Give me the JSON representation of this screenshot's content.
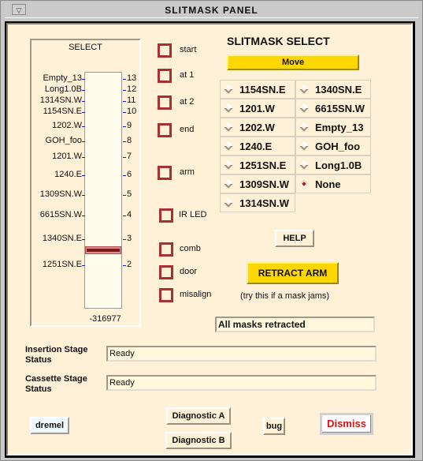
{
  "window": {
    "title": "SLITMASK PANEL",
    "menu_icon": "triangle-down-icon"
  },
  "gauge": {
    "title": "SELECT",
    "positions": [
      {
        "name": "Empty_13",
        "index": "13"
      },
      {
        "name": "Long1.0B",
        "index": "12"
      },
      {
        "name": "1314SN.W",
        "index": "11"
      },
      {
        "name": "1154SN.E",
        "index": "10"
      },
      {
        "name": "1202.W",
        "index": "9"
      },
      {
        "name": "GOH_foo",
        "index": "8"
      },
      {
        "name": "1201.W",
        "index": "7"
      },
      {
        "name": "1240.E",
        "index": "6"
      },
      {
        "name": "1309SN.W",
        "index": "5"
      },
      {
        "name": "6615SN.W",
        "index": "4"
      },
      {
        "name": "1340SN.E",
        "index": "3"
      },
      {
        "name": "1251SN.E",
        "index": "2"
      }
    ],
    "current_position": "3",
    "readout": "-316977"
  },
  "indicators": [
    {
      "label": "start"
    },
    {
      "label": "at 1"
    },
    {
      "label": "at 2"
    },
    {
      "label": "end"
    },
    {
      "label": "arm"
    },
    {
      "label": "IR LED"
    },
    {
      "label": "comb"
    },
    {
      "label": "door"
    },
    {
      "label": "misalign"
    }
  ],
  "slitmask_select": {
    "title": "SLITMASK SELECT",
    "move_label": "Move",
    "options_col1": [
      "1154SN.E",
      "1201.W",
      "1202.W",
      "1240.E",
      "1251SN.E",
      "1309SN.W",
      "1314SN.W"
    ],
    "options_col2": [
      "1340SN.E",
      "6615SN.W",
      "Empty_13",
      "GOH_foo",
      "Long1.0B",
      "None"
    ],
    "selected": "None"
  },
  "help_label": "HELP",
  "retract_label": "RETRACT ARM",
  "retract_hint": "(try this if a mask jams)",
  "mask_status": "All masks retracted",
  "insertion_stage": {
    "label_line1": "Insertion Stage",
    "label_line2": "Status",
    "value": "Ready"
  },
  "cassette_stage": {
    "label_line1": "Cassette Stage",
    "label_line2": "Status",
    "value": "Ready"
  },
  "buttons": {
    "dremel": "dremel",
    "diag_a": "Diagnostic A",
    "diag_b": "Diagnostic B",
    "bug": "bug",
    "dismiss": "Dismiss"
  },
  "colors": {
    "panel_bg": "#fff0d8",
    "accent_yellow": "#ffd700",
    "indicator_red": "#a83030",
    "dismiss_red": "#e01010"
  }
}
